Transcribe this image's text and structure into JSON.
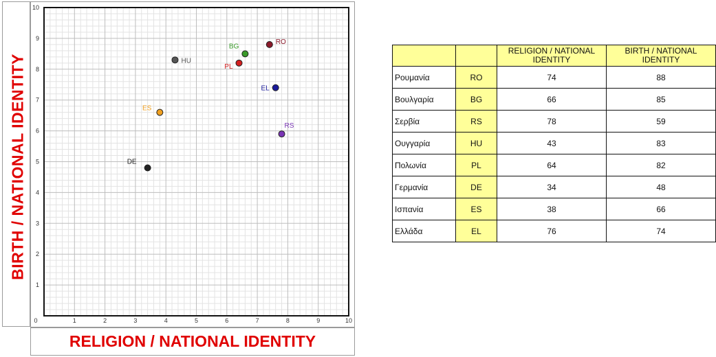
{
  "chart_data": {
    "type": "scatter",
    "xlabel": "RELIGION / NATIONAL IDENTITY",
    "ylabel": "BIRTH / NATIONAL IDENTITY",
    "xlim": [
      0,
      10
    ],
    "ylim": [
      0,
      10
    ],
    "xticks": [
      "0",
      "1",
      "2",
      "3",
      "4",
      "5",
      "6",
      "7",
      "8",
      "9",
      "10"
    ],
    "yticks": [
      "1",
      "2",
      "3",
      "4",
      "5",
      "6",
      "7",
      "8",
      "9",
      "10"
    ],
    "grid": true,
    "points": [
      {
        "label": "RO",
        "x": 7.4,
        "y": 8.8,
        "color": "#8b1a2b"
      },
      {
        "label": "BG",
        "x": 6.6,
        "y": 8.5,
        "color": "#3a9a2a"
      },
      {
        "label": "RS",
        "x": 7.8,
        "y": 5.9,
        "color": "#7a35b5"
      },
      {
        "label": "HU",
        "x": 4.3,
        "y": 8.3,
        "color": "#555555"
      },
      {
        "label": "PL",
        "x": 6.4,
        "y": 8.2,
        "color": "#d41f1f"
      },
      {
        "label": "DE",
        "x": 3.4,
        "y": 4.8,
        "color": "#222222"
      },
      {
        "label": "ES",
        "x": 3.8,
        "y": 6.6,
        "color": "#f0a020"
      },
      {
        "label": "EL",
        "x": 7.6,
        "y": 7.4,
        "color": "#1a1a9a"
      }
    ]
  },
  "table": {
    "headers": [
      "",
      "",
      "RELIGION / NATIONAL IDENTITY",
      "BIRTH / NATIONAL IDENTITY"
    ],
    "rows": [
      {
        "country": "Ρουμανία",
        "code": "RO",
        "religion": "74",
        "birth": "88"
      },
      {
        "country": "Βουλγαρία",
        "code": "BG",
        "religion": "66",
        "birth": "85"
      },
      {
        "country": "Σερβία",
        "code": "RS",
        "religion": "78",
        "birth": "59"
      },
      {
        "country": "Ουγγαρία",
        "code": "HU",
        "religion": "43",
        "birth": "83"
      },
      {
        "country": "Πολωνία",
        "code": "PL",
        "religion": "64",
        "birth": "82"
      },
      {
        "country": "Γερμανία",
        "code": "DE",
        "religion": "34",
        "birth": "48"
      },
      {
        "country": "Ισπανία",
        "code": "ES",
        "religion": "38",
        "birth": "66"
      },
      {
        "country": "Ελλάδα",
        "code": "EL",
        "religion": "76",
        "birth": "74"
      }
    ]
  }
}
